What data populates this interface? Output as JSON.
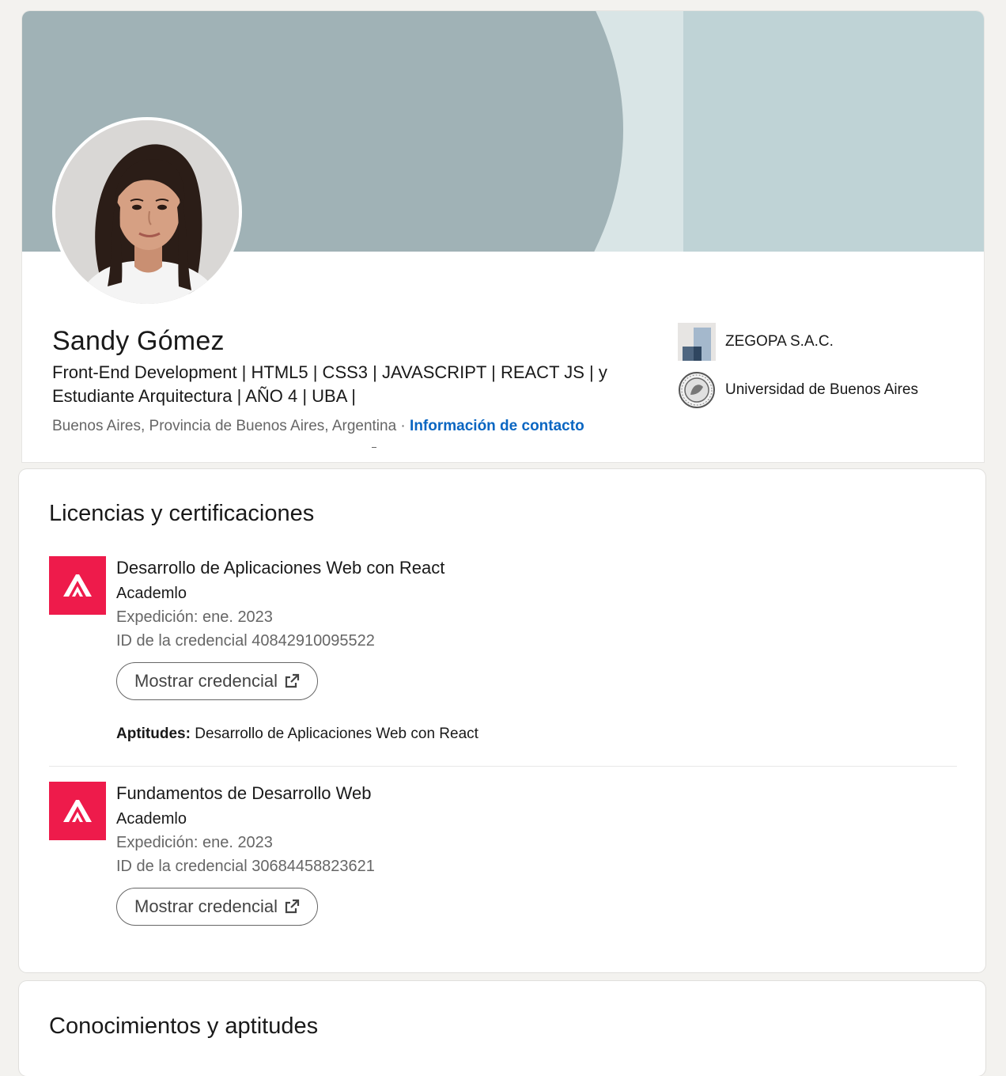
{
  "profile": {
    "name": "Sandy Gómez",
    "headline": "Front-End Development | HTML5 | CSS3 | JAVASCRIPT | REACT JS | y Estudiante Arquitectura | AÑO 4 | UBA |",
    "location": "Buenos Aires, Provincia de Buenos Aires, Argentina",
    "separator": " · ",
    "contact_link": "Información de contacto",
    "affiliations": [
      {
        "name": "ZEGOPA S.A.C.",
        "logo": "zegopa-logo"
      },
      {
        "name": "Universidad de Buenos Aires",
        "logo": "uba-seal-logo"
      }
    ]
  },
  "licenses": {
    "title": "Licencias y certificaciones",
    "items": [
      {
        "title": "Desarrollo de Aplicaciones Web con React",
        "issuer": "Academlo",
        "issued": "Expedición: ene. 2023",
        "credential_id": "ID de la credencial 40842910095522",
        "button": "Mostrar credencial",
        "skills_label": "Aptitudes:",
        "skills": " Desarrollo de Aplicaciones Web con React"
      },
      {
        "title": "Fundamentos de Desarrollo Web",
        "issuer": "Academlo",
        "issued": "Expedición: ene. 2023",
        "credential_id": "ID de la credencial 30684458823621",
        "button": "Mostrar credencial"
      }
    ]
  },
  "skills_section": {
    "title": "Conocimientos y aptitudes"
  },
  "colors": {
    "banner_light": "#bfd3d6",
    "banner_dark": "#a0b2b6",
    "link": "#0a66c2",
    "academlo_red": "#ee1b4b",
    "page_bg": "#f3f2ef"
  }
}
